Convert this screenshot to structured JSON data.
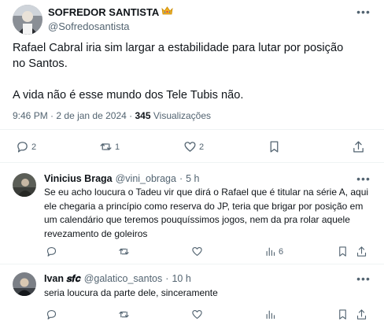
{
  "main_tweet": {
    "author_name": "SOFREDOR SANTISTA",
    "author_handle": "@Sofredosantista",
    "paragraphs": [
      "Rafael Cabral iria sim largar a estabilidade para lutar por posição no Santos.",
      "A vida não é esse mundo dos Tele Tubis não."
    ],
    "time": "9:46 PM",
    "date": "2 de jan de 2024",
    "views_count": "345",
    "views_label": "Visualizações",
    "replies": "2",
    "retweets": "1",
    "likes": "2"
  },
  "replies": [
    {
      "name": "Vinicius Braga",
      "handle": "@vini_obraga",
      "time": "5 h",
      "text": "Se eu acho loucura o Tadeu vir que dirá o Rafael que é titular na série A, aqui ele chegaria a princípio como reserva do JP, teria que brigar por posição em um calendário que teremos pouquíssimos jogos, nem da pra rolar aquele revezamento de goleiros",
      "views": "6"
    },
    {
      "name": "Ivan 𝒔𝒇𝒄",
      "handle": "@galatico_santos",
      "time": "10 h",
      "text": "seria loucura da parte dele, sinceramente"
    }
  ],
  "colors": {
    "text": "#0f1419",
    "secondary": "#536471",
    "divider": "#eff3f4",
    "badge": "#f2b01e"
  },
  "icons": [
    "reply-icon",
    "retweet-icon",
    "like-icon",
    "bookmark-icon",
    "share-icon",
    "views-icon",
    "more-icon",
    "crown-icon"
  ]
}
